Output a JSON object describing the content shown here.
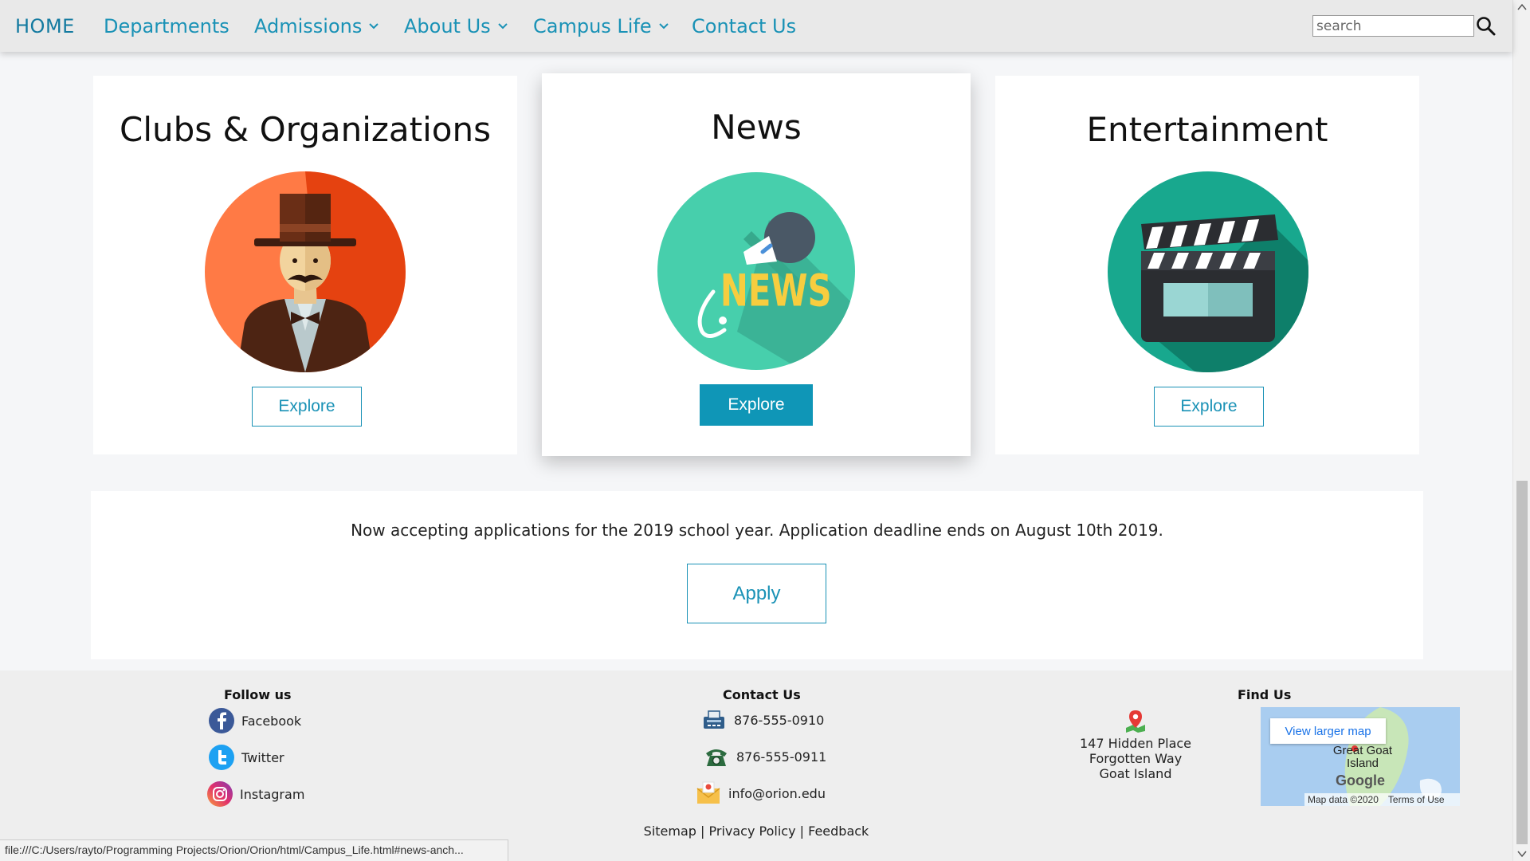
{
  "nav": {
    "items": [
      {
        "label": "HOME",
        "dropdown": false
      },
      {
        "label": "Departments",
        "dropdown": false
      },
      {
        "label": "Admissions",
        "dropdown": true
      },
      {
        "label": "About Us",
        "dropdown": true
      },
      {
        "label": "Campus Life",
        "dropdown": true
      },
      {
        "label": "Contact Us",
        "dropdown": false
      }
    ],
    "search_placeholder": "search",
    "search_value": ""
  },
  "cards": [
    {
      "title": "Clubs & Organizations",
      "icon": "gentleman-icon",
      "button": "Explore"
    },
    {
      "title": "News",
      "icon": "news-microphone-icon",
      "button": "Explore"
    },
    {
      "title": "Entertainment",
      "icon": "clapperboard-icon",
      "button": "Explore"
    }
  ],
  "announcement": {
    "text": "Now accepting applications for the 2019 school year. Application deadline ends on August 10th 2019.",
    "button": "Apply"
  },
  "footer": {
    "follow": {
      "heading": "Follow us",
      "links": [
        {
          "label": "Facebook",
          "icon": "facebook-icon"
        },
        {
          "label": "Twitter",
          "icon": "twitter-icon"
        },
        {
          "label": "Instagram",
          "icon": "instagram-icon"
        }
      ]
    },
    "contact": {
      "heading": "Contact Us",
      "items": [
        {
          "label": "876-555-0910",
          "icon": "fax-icon"
        },
        {
          "label": "876-555-0911",
          "icon": "phone-icon"
        },
        {
          "label": "info@orion.edu",
          "icon": "mail-icon"
        }
      ]
    },
    "address": [
      "147 Hidden Place",
      "Forgotten Way",
      "Goat Island"
    ],
    "find_us": {
      "heading": "Find Us",
      "map_button": "View larger map",
      "map_label": "Great Goat Island",
      "map_brand": "Google",
      "map_data": "Map data ©2020",
      "map_terms": "Terms of Use"
    },
    "links": [
      "Sitemap",
      "Privacy Policy",
      "Feedback"
    ]
  },
  "status_url": "file:///C:/Users/rayto/Programming Projects/Orion/Orion/html/Campus_Life.html#news-anch...",
  "colors": {
    "accent": "#1a92b6",
    "button_filled": "#0f96b7",
    "nav_bg": "#e9e9e9",
    "footer_bg": "#eeeeee"
  }
}
